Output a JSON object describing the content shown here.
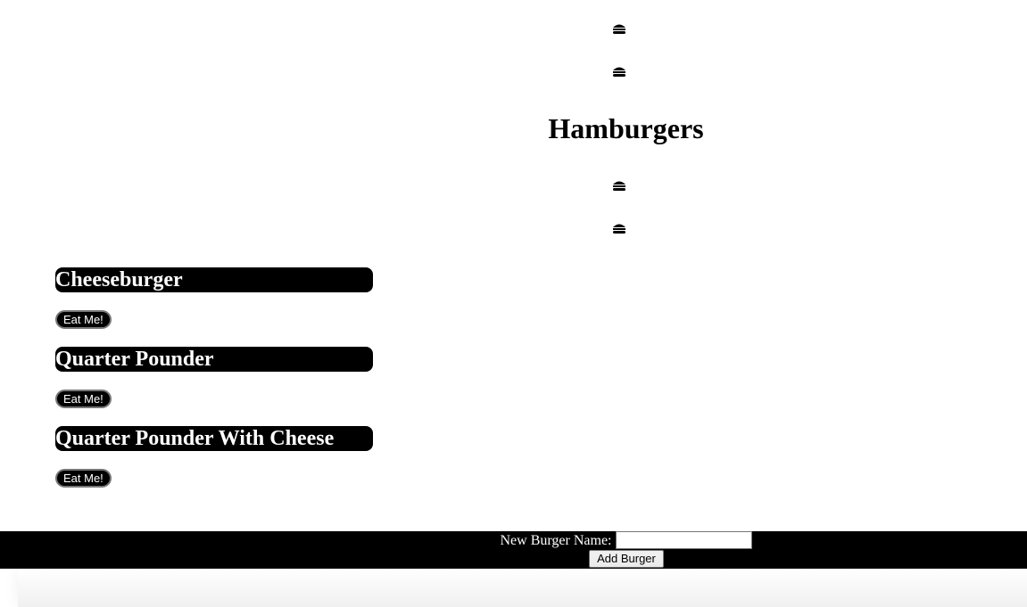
{
  "title": "Hamburgers",
  "burgers": [
    {
      "name": "Cheeseburger",
      "button_label": "Eat Me!"
    },
    {
      "name": "Quarter Pounder",
      "button_label": "Eat Me!"
    },
    {
      "name": "Quarter Pounder With Cheese",
      "button_label": "Eat Me!"
    }
  ],
  "form": {
    "label": "New Burger Name:",
    "input_value": "",
    "submit_label": "Add Burger"
  },
  "icons": [
    "hamburger-icon",
    "hamburger-icon",
    "hamburger-icon",
    "hamburger-icon"
  ],
  "colors": {
    "background": "#ffffff",
    "burger_bar": "#000000",
    "burger_text": "#ffffff"
  }
}
